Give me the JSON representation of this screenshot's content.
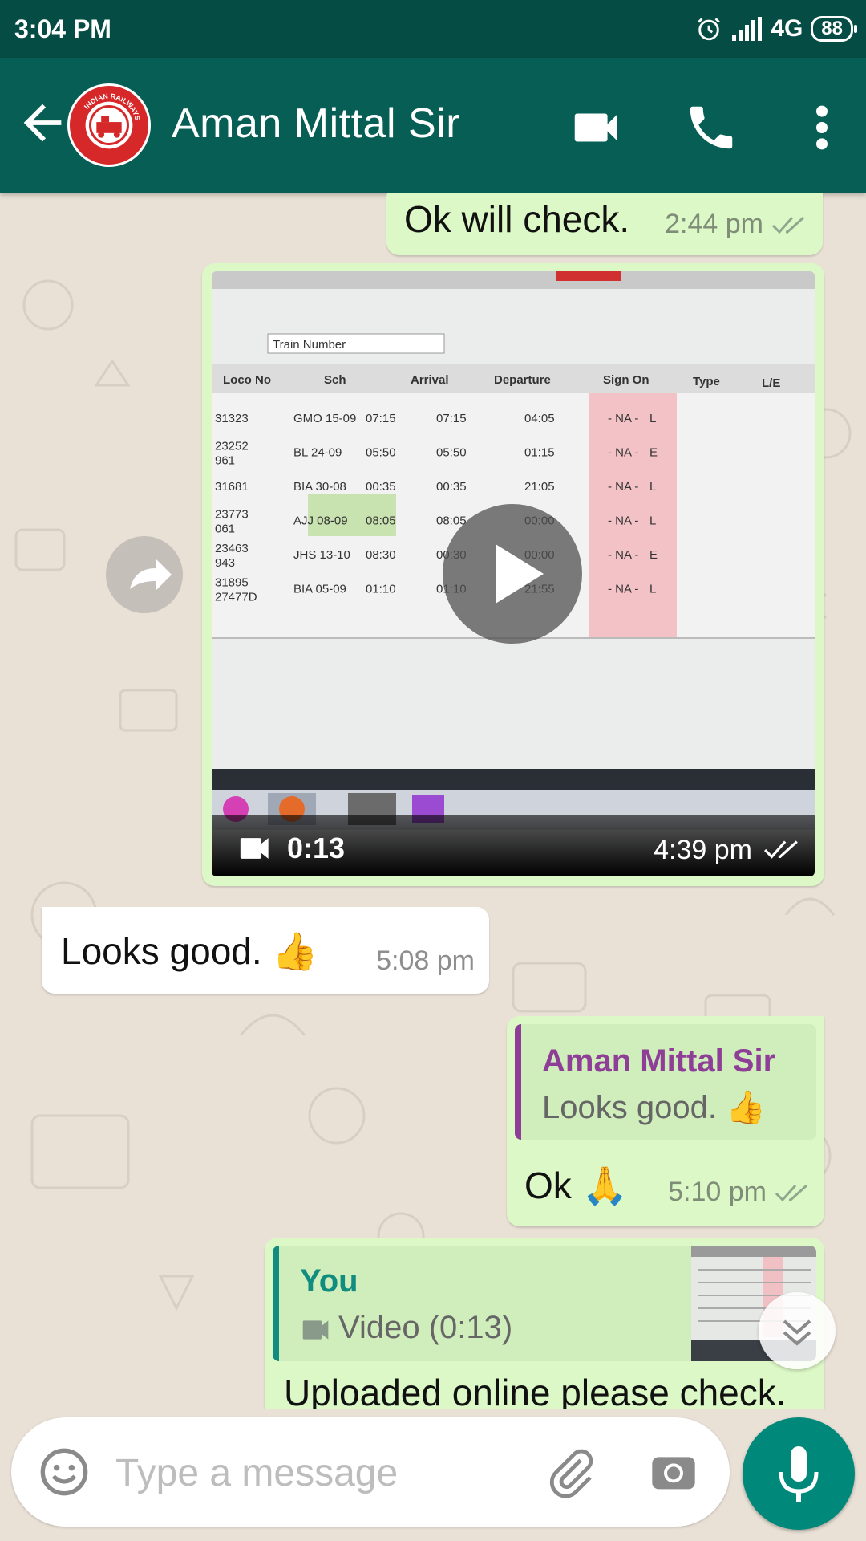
{
  "status_bar": {
    "time": "3:04 PM",
    "network": "4G",
    "battery": "88"
  },
  "header": {
    "contact_name": "Aman Mittal Sir",
    "avatar_icon": "indian-railways-logo",
    "avatar_text": "INDIAN RAILWAYS"
  },
  "messages": {
    "m1": {
      "text": "Ok will check.",
      "time": "2:44 pm",
      "status": "read"
    },
    "m2": {
      "duration": "0:13",
      "time": "4:39 pm",
      "status": "read",
      "preview": {
        "input_placeholder": "Train Number",
        "columns": [
          "Loco No",
          "Sch",
          "Arrival",
          "Departure",
          "Sign On",
          "Type",
          "L/E"
        ],
        "rows": [
          [
            "31323",
            "GMO 15-09",
            "07:15",
            "07:15",
            "04:05",
            "- NA -",
            "L"
          ],
          [
            "23252\n961",
            "BL 24-09",
            "05:50",
            "05:50",
            "01:15",
            "- NA -",
            "E"
          ],
          [
            "31681",
            "BIA 30-08",
            "00:35",
            "00:35",
            "21:05",
            "- NA -",
            "L"
          ],
          [
            "23773\n061",
            "AJJ 08-09",
            "08:05",
            "08:05",
            "00:00",
            "- NA -",
            "L"
          ],
          [
            "23463\n943",
            "JHS 13-10",
            "08:30",
            "00:30",
            "00:00",
            "- NA -",
            "E"
          ],
          [
            "31895\n27477D",
            "BIA 05-09",
            "01:10",
            "01:10",
            "21:55",
            "- NA -",
            "L"
          ]
        ]
      }
    },
    "m3": {
      "text": "Looks good. 👍",
      "time": "5:08 pm"
    },
    "m4": {
      "quote_author": "Aman Mittal Sir",
      "quote_text": "Looks good. 👍",
      "text": "Ok 🙏",
      "time": "5:10 pm",
      "status": "read"
    },
    "m5": {
      "quote_author": "You",
      "quote_text": "Video (0:13)",
      "text": "Uploaded online please check."
    }
  },
  "composer": {
    "placeholder": "Type a message"
  },
  "colors": {
    "header": "#075e54",
    "status_bar": "#054d44",
    "outgoing_bubble": "#dcf8c6",
    "incoming_bubble": "#ffffff",
    "chat_background": "#e9e1d6",
    "mic_button": "#00897b",
    "quote_purple": "#8e3e96",
    "quote_teal": "#128c7e"
  }
}
